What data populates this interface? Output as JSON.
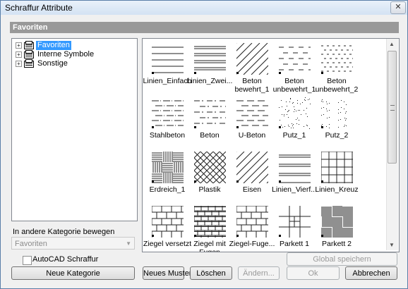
{
  "window": {
    "title": "Schraffur Attribute",
    "close_glyph": "✕"
  },
  "header": {
    "label": "Favoriten"
  },
  "tree": {
    "items": [
      {
        "label": "Favoriten",
        "selected": true
      },
      {
        "label": "Interne Symbole",
        "selected": false
      },
      {
        "label": "Sonstige",
        "selected": false
      }
    ]
  },
  "move": {
    "label": "In andere Kategorie bewegen",
    "value": "Favoriten"
  },
  "autocad": {
    "label": "AutoCAD Schraffur",
    "checked": false
  },
  "buttons": {
    "neue_kategorie": "Neue Kategorie",
    "neues_muster": "Neues Muster",
    "loeschen": "Löschen",
    "aendern": "Ändern...",
    "ok": "Ok",
    "abbrechen": "Abbrechen",
    "global_speichern": "Global speichern"
  },
  "patterns": [
    {
      "label": "Linien_Einfach",
      "kind": "hlines-wide"
    },
    {
      "label": "Linien_Zwei...",
      "kind": "hlines-double"
    },
    {
      "label": "Beton bewehrt_1",
      "kind": "diag-wide"
    },
    {
      "label": "Beton unbewehrt_1",
      "kind": "dashes"
    },
    {
      "label": "Beton unbewehrt_2",
      "kind": "dashes-dense"
    },
    {
      "label": "Stahlbeton",
      "kind": "dashdot"
    },
    {
      "label": "Beton",
      "kind": "dashes2"
    },
    {
      "label": "U-Beton",
      "kind": "dashes3"
    },
    {
      "label": "Putz_1",
      "kind": "dots"
    },
    {
      "label": "Putz_2",
      "kind": "dots2"
    },
    {
      "label": "Erdreich_1",
      "kind": "weave"
    },
    {
      "label": "Plastik",
      "kind": "crosshatch"
    },
    {
      "label": "Eisen",
      "kind": "diag-wide"
    },
    {
      "label": "Linien_Vierf...",
      "kind": "hlines-four"
    },
    {
      "label": "Linien_Kreuz",
      "kind": "grid"
    },
    {
      "label": "Ziegel versetzt",
      "kind": "bricks"
    },
    {
      "label": "Ziegel mit Fugen",
      "kind": "bricks-small"
    },
    {
      "label": "Ziegel-Fuge...",
      "kind": "bricks"
    },
    {
      "label": "Parkett 1",
      "kind": "parquet"
    },
    {
      "label": "Parkett 2",
      "kind": "parquet2"
    }
  ]
}
